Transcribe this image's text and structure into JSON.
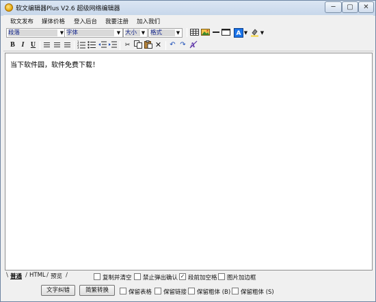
{
  "window": {
    "title": "软文编辑器Plus V2.6 超级网络编辑器",
    "controls": {
      "minimize": "─",
      "maximize": "▢",
      "close": "✕"
    }
  },
  "menu": {
    "items": [
      {
        "label": "软文发布"
      },
      {
        "label": "媒体价格"
      },
      {
        "label": "登入后台"
      },
      {
        "label": "我要注册"
      },
      {
        "label": "加入我们"
      }
    ]
  },
  "toolbar": {
    "paragraph_select": "段落",
    "font_select": "字体",
    "size_select": "大小",
    "format_select": "格式",
    "icons": [
      "table-icon",
      "insert-image-icon",
      "horizontal-rule-icon",
      "frame-icon",
      "font-color-icon",
      "highlight-color-icon",
      "bold-icon",
      "italic-icon",
      "underline-icon",
      "align-left-icon",
      "align-center-icon",
      "align-right-icon",
      "ordered-list-icon",
      "unordered-list-icon",
      "outdent-icon",
      "indent-icon",
      "cut-icon",
      "copy-icon",
      "paste-icon",
      "delete-icon",
      "undo-icon",
      "redo-icon",
      "clear-format-icon"
    ],
    "font_color": "#1a73e8",
    "highlight_color": "#f7d84a",
    "bold": "B",
    "italic": "I",
    "underline": "U",
    "font_color_letter": "A"
  },
  "editor": {
    "content": "当下软件园，软件免费下载！"
  },
  "tabs": [
    {
      "label": "普通",
      "active": true
    },
    {
      "label": "HTML",
      "active": false
    },
    {
      "label": "预览",
      "active": false
    }
  ],
  "options_row1": [
    {
      "label": "复制并清空",
      "checked": false
    },
    {
      "label": "禁止弹出确认",
      "checked": false
    },
    {
      "label": "段前加空格",
      "checked": true
    },
    {
      "label": "图片加边框",
      "checked": false
    }
  ],
  "buttons": {
    "proofread": "文字纠错",
    "convert": "简繁转换"
  },
  "options_row2": [
    {
      "label": "保留表格",
      "checked": false
    },
    {
      "label": "保留链接",
      "checked": false
    },
    {
      "label": "保留粗体 (B)",
      "checked": false
    },
    {
      "label": "保留粗体 (S)",
      "checked": false
    }
  ],
  "check_mark": "✓"
}
